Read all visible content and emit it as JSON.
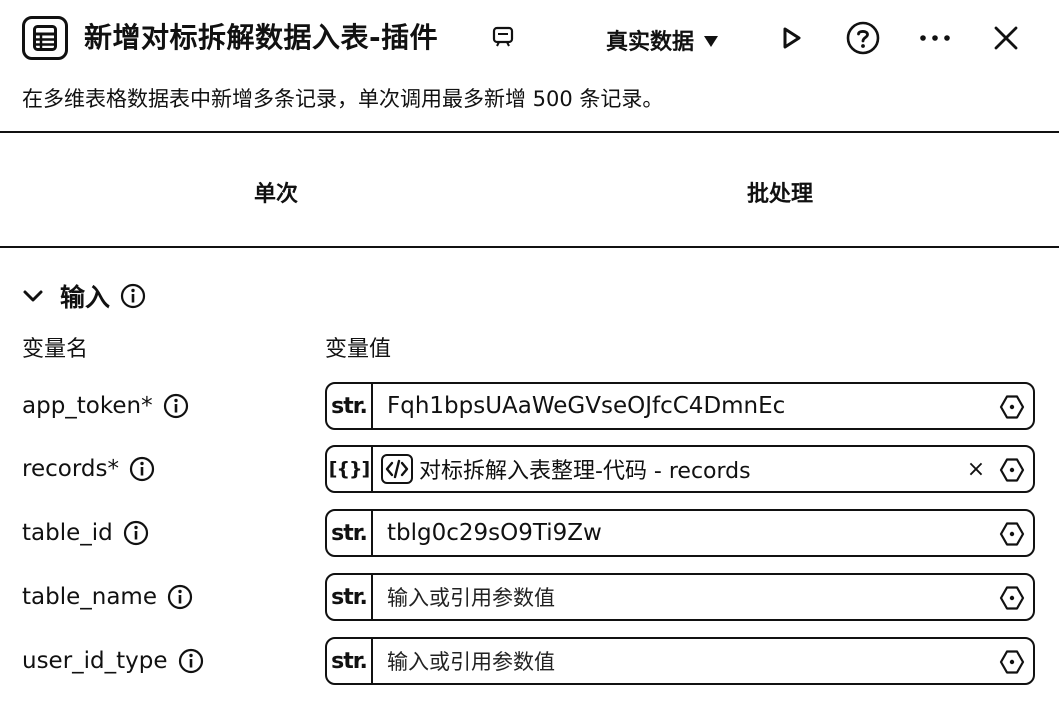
{
  "header": {
    "title": "新增对标拆解数据入表-插件",
    "icon": "table-doc-icon",
    "edit_icon": "edit-icon",
    "mode_label": "真实数据",
    "actions": [
      "run-icon",
      "help-icon",
      "more-icon",
      "close-icon"
    ]
  },
  "description": "在多维表格数据表中新增多条记录，单次调用最多新增 500 条记录。",
  "tabs": [
    {
      "label": "单次"
    },
    {
      "label": "批处理"
    }
  ],
  "input_section": {
    "title": "输入",
    "col_name": "变量名",
    "col_value": "变量值",
    "rows": [
      {
        "name": "app_token*",
        "type": "str.",
        "value": "Fqh1bpsUAaWeGVseOJfcC4DmnEc"
      },
      {
        "name": "records*",
        "type": "[{}]",
        "value": "对标拆解入表整理-代码 - records"
      },
      {
        "name": "table_id",
        "type": "str.",
        "value": "tblg0c29sO9Ti9Zw"
      },
      {
        "name": "table_name",
        "type": "str.",
        "placeholder": "输入或引用参数值"
      },
      {
        "name": "user_id_type",
        "type": "str.",
        "placeholder": "输入或引用参数值"
      }
    ]
  }
}
